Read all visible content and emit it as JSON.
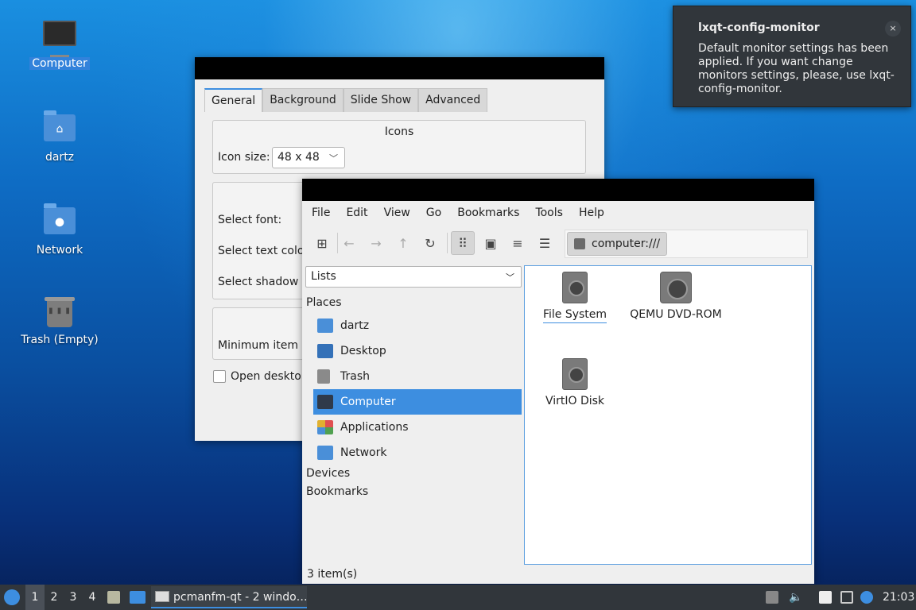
{
  "desktop": {
    "icons": [
      {
        "label": "Computer"
      },
      {
        "label": "dartz"
      },
      {
        "label": "Network"
      },
      {
        "label": "Trash (Empty)"
      }
    ]
  },
  "prefs": {
    "tabs": [
      "General",
      "Background",
      "Slide Show",
      "Advanced"
    ],
    "icons_group_title": "Icons",
    "icon_size_label": "Icon size:",
    "icon_size_value": "48 x 48",
    "select_font": "Select font:",
    "select_text_color": "Select text colo",
    "select_shadow": "Select shadow c",
    "min_item": "Minimum item r",
    "open_desktop": "Open desktop"
  },
  "fm": {
    "menu": [
      "File",
      "Edit",
      "View",
      "Go",
      "Bookmarks",
      "Tools",
      "Help"
    ],
    "path": "computer:///",
    "side_combo": "Lists",
    "places_header": "Places",
    "places": [
      {
        "label": "dartz",
        "icon": "folder-home-icon"
      },
      {
        "label": "Desktop",
        "icon": "desktop-icon"
      },
      {
        "label": "Trash",
        "icon": "trash-icon"
      },
      {
        "label": "Computer",
        "icon": "computer-icon"
      },
      {
        "label": "Applications",
        "icon": "applications-icon"
      },
      {
        "label": "Network",
        "icon": "network-icon"
      }
    ],
    "devices_header": "Devices",
    "bookmarks_header": "Bookmarks",
    "files": [
      {
        "label": "File System"
      },
      {
        "label": "QEMU DVD-ROM"
      },
      {
        "label": "VirtIO Disk"
      }
    ],
    "status": "3 item(s)"
  },
  "notification": {
    "title": "lxqt-config-monitor",
    "body": "Default monitor settings has been applied. If you want change monitors settings, please, use lxqt-config-monitor.",
    "close": "×"
  },
  "taskbar": {
    "workspaces": [
      "1",
      "2",
      "3",
      "4"
    ],
    "task_label": "pcmanfm-qt - 2 windo…",
    "clock": "21:03"
  },
  "colors": {
    "accent": "#3d8ee0",
    "panel": "#31363b"
  }
}
